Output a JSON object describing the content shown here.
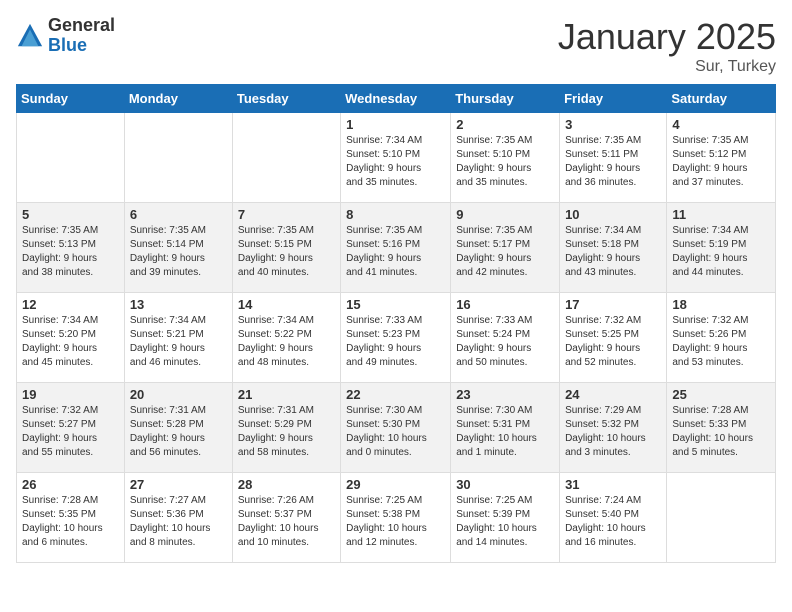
{
  "logo": {
    "general": "General",
    "blue": "Blue"
  },
  "header": {
    "title": "January 2025",
    "location": "Sur, Turkey"
  },
  "days_of_week": [
    "Sunday",
    "Monday",
    "Tuesday",
    "Wednesday",
    "Thursday",
    "Friday",
    "Saturday"
  ],
  "weeks": [
    [
      {
        "day": "",
        "info": ""
      },
      {
        "day": "",
        "info": ""
      },
      {
        "day": "",
        "info": ""
      },
      {
        "day": "1",
        "info": "Sunrise: 7:34 AM\nSunset: 5:10 PM\nDaylight: 9 hours\nand 35 minutes."
      },
      {
        "day": "2",
        "info": "Sunrise: 7:35 AM\nSunset: 5:10 PM\nDaylight: 9 hours\nand 35 minutes."
      },
      {
        "day": "3",
        "info": "Sunrise: 7:35 AM\nSunset: 5:11 PM\nDaylight: 9 hours\nand 36 minutes."
      },
      {
        "day": "4",
        "info": "Sunrise: 7:35 AM\nSunset: 5:12 PM\nDaylight: 9 hours\nand 37 minutes."
      }
    ],
    [
      {
        "day": "5",
        "info": "Sunrise: 7:35 AM\nSunset: 5:13 PM\nDaylight: 9 hours\nand 38 minutes."
      },
      {
        "day": "6",
        "info": "Sunrise: 7:35 AM\nSunset: 5:14 PM\nDaylight: 9 hours\nand 39 minutes."
      },
      {
        "day": "7",
        "info": "Sunrise: 7:35 AM\nSunset: 5:15 PM\nDaylight: 9 hours\nand 40 minutes."
      },
      {
        "day": "8",
        "info": "Sunrise: 7:35 AM\nSunset: 5:16 PM\nDaylight: 9 hours\nand 41 minutes."
      },
      {
        "day": "9",
        "info": "Sunrise: 7:35 AM\nSunset: 5:17 PM\nDaylight: 9 hours\nand 42 minutes."
      },
      {
        "day": "10",
        "info": "Sunrise: 7:34 AM\nSunset: 5:18 PM\nDaylight: 9 hours\nand 43 minutes."
      },
      {
        "day": "11",
        "info": "Sunrise: 7:34 AM\nSunset: 5:19 PM\nDaylight: 9 hours\nand 44 minutes."
      }
    ],
    [
      {
        "day": "12",
        "info": "Sunrise: 7:34 AM\nSunset: 5:20 PM\nDaylight: 9 hours\nand 45 minutes."
      },
      {
        "day": "13",
        "info": "Sunrise: 7:34 AM\nSunset: 5:21 PM\nDaylight: 9 hours\nand 46 minutes."
      },
      {
        "day": "14",
        "info": "Sunrise: 7:34 AM\nSunset: 5:22 PM\nDaylight: 9 hours\nand 48 minutes."
      },
      {
        "day": "15",
        "info": "Sunrise: 7:33 AM\nSunset: 5:23 PM\nDaylight: 9 hours\nand 49 minutes."
      },
      {
        "day": "16",
        "info": "Sunrise: 7:33 AM\nSunset: 5:24 PM\nDaylight: 9 hours\nand 50 minutes."
      },
      {
        "day": "17",
        "info": "Sunrise: 7:32 AM\nSunset: 5:25 PM\nDaylight: 9 hours\nand 52 minutes."
      },
      {
        "day": "18",
        "info": "Sunrise: 7:32 AM\nSunset: 5:26 PM\nDaylight: 9 hours\nand 53 minutes."
      }
    ],
    [
      {
        "day": "19",
        "info": "Sunrise: 7:32 AM\nSunset: 5:27 PM\nDaylight: 9 hours\nand 55 minutes."
      },
      {
        "day": "20",
        "info": "Sunrise: 7:31 AM\nSunset: 5:28 PM\nDaylight: 9 hours\nand 56 minutes."
      },
      {
        "day": "21",
        "info": "Sunrise: 7:31 AM\nSunset: 5:29 PM\nDaylight: 9 hours\nand 58 minutes."
      },
      {
        "day": "22",
        "info": "Sunrise: 7:30 AM\nSunset: 5:30 PM\nDaylight: 10 hours\nand 0 minutes."
      },
      {
        "day": "23",
        "info": "Sunrise: 7:30 AM\nSunset: 5:31 PM\nDaylight: 10 hours\nand 1 minute."
      },
      {
        "day": "24",
        "info": "Sunrise: 7:29 AM\nSunset: 5:32 PM\nDaylight: 10 hours\nand 3 minutes."
      },
      {
        "day": "25",
        "info": "Sunrise: 7:28 AM\nSunset: 5:33 PM\nDaylight: 10 hours\nand 5 minutes."
      }
    ],
    [
      {
        "day": "26",
        "info": "Sunrise: 7:28 AM\nSunset: 5:35 PM\nDaylight: 10 hours\nand 6 minutes."
      },
      {
        "day": "27",
        "info": "Sunrise: 7:27 AM\nSunset: 5:36 PM\nDaylight: 10 hours\nand 8 minutes."
      },
      {
        "day": "28",
        "info": "Sunrise: 7:26 AM\nSunset: 5:37 PM\nDaylight: 10 hours\nand 10 minutes."
      },
      {
        "day": "29",
        "info": "Sunrise: 7:25 AM\nSunset: 5:38 PM\nDaylight: 10 hours\nand 12 minutes."
      },
      {
        "day": "30",
        "info": "Sunrise: 7:25 AM\nSunset: 5:39 PM\nDaylight: 10 hours\nand 14 minutes."
      },
      {
        "day": "31",
        "info": "Sunrise: 7:24 AM\nSunset: 5:40 PM\nDaylight: 10 hours\nand 16 minutes."
      },
      {
        "day": "",
        "info": ""
      }
    ]
  ]
}
